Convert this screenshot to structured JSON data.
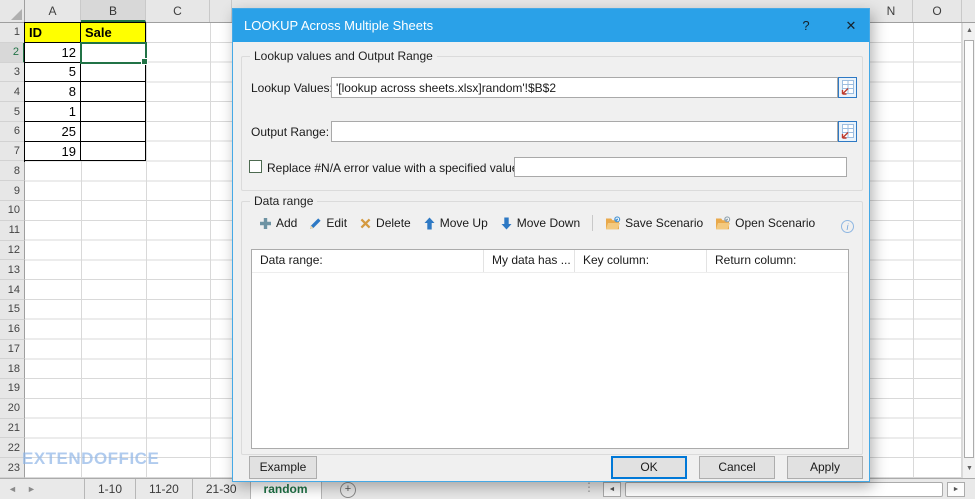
{
  "colors": {
    "accent_blue": "#2AA1E8",
    "excel_green": "#217346",
    "header_yellow": "#FFFF00"
  },
  "spreadsheet": {
    "column_headers": [
      {
        "label": "A",
        "selected": false
      },
      {
        "label": "B",
        "selected": true
      },
      {
        "label": "C",
        "selected": false
      },
      {
        "label": "N",
        "selected": false
      },
      {
        "label": "O",
        "selected": false
      }
    ],
    "visible_rows": 23,
    "selected_row": 2,
    "selected_cell": "B2",
    "cells": [
      {
        "ref": "A1",
        "col": "A",
        "row": 1,
        "value": "ID",
        "header": true
      },
      {
        "ref": "B1",
        "col": "B",
        "row": 1,
        "value": "Sale",
        "header": true
      },
      {
        "ref": "A2",
        "col": "A",
        "row": 2,
        "value": "12",
        "header": false
      },
      {
        "ref": "A3",
        "col": "A",
        "row": 3,
        "value": "5",
        "header": false
      },
      {
        "ref": "A4",
        "col": "A",
        "row": 4,
        "value": "8",
        "header": false
      },
      {
        "ref": "A5",
        "col": "A",
        "row": 5,
        "value": "1",
        "header": false
      },
      {
        "ref": "A6",
        "col": "A",
        "row": 6,
        "value": "25",
        "header": false
      },
      {
        "ref": "A7",
        "col": "A",
        "row": 7,
        "value": "19",
        "header": false
      },
      {
        "ref": "B2",
        "col": "B",
        "row": 2,
        "value": "",
        "header": false
      },
      {
        "ref": "B3",
        "col": "B",
        "row": 3,
        "value": "",
        "header": false
      },
      {
        "ref": "B4",
        "col": "B",
        "row": 4,
        "value": "",
        "header": false
      },
      {
        "ref": "B5",
        "col": "B",
        "row": 5,
        "value": "",
        "header": false
      },
      {
        "ref": "B6",
        "col": "B",
        "row": 6,
        "value": "",
        "header": false
      },
      {
        "ref": "B7",
        "col": "B",
        "row": 7,
        "value": "",
        "header": false
      }
    ],
    "watermark": "EXTENDOFFICE"
  },
  "dialog": {
    "title": "LOOKUP Across Multiple Sheets",
    "help_glyph": "?",
    "close_glyph": "✕",
    "lookup_group": {
      "label": "Lookup values and Output Range",
      "lookup_values": {
        "label": "Lookup Values:",
        "value": "'[lookup across sheets.xlsx]random'!$B$2"
      },
      "output_range": {
        "label": "Output Range:",
        "value": ""
      },
      "replace_na": {
        "label": "Replace #N/A error value with a specified value:",
        "checked": false,
        "value": ""
      }
    },
    "data_range_group": {
      "label": "Data range",
      "toolbar": [
        {
          "icon": "add-plus-icon",
          "label": "Add"
        },
        {
          "icon": "edit-pencil-icon",
          "label": "Edit"
        },
        {
          "icon": "delete-x-icon",
          "label": "Delete"
        },
        {
          "icon": "move-up-arrow-icon",
          "label": "Move Up"
        },
        {
          "icon": "move-down-arrow-icon",
          "label": "Move Down"
        },
        {
          "icon": "save-scenario-folder-icon",
          "label": "Save Scenario"
        },
        {
          "icon": "open-scenario-folder-icon",
          "label": "Open Scenario"
        }
      ],
      "info_glyph": "i",
      "list_columns": [
        "Data range:",
        "My data has ...",
        "Key column:",
        "Return column:"
      ]
    },
    "footer": {
      "example": "Example",
      "ok": "OK",
      "cancel": "Cancel",
      "apply": "Apply"
    }
  },
  "tabbar": {
    "nav_left": "◄",
    "nav_right": "►",
    "tabs": [
      {
        "label": "1-10",
        "active": false
      },
      {
        "label": "11-20",
        "active": false
      },
      {
        "label": "21-30",
        "active": false
      },
      {
        "label": "random",
        "active": true
      }
    ],
    "new_sheet_glyph": "+",
    "dots_glyph": "⋮"
  },
  "scrollbars": {
    "up": "▲",
    "down": "▼",
    "left": "◄",
    "right": "►"
  }
}
